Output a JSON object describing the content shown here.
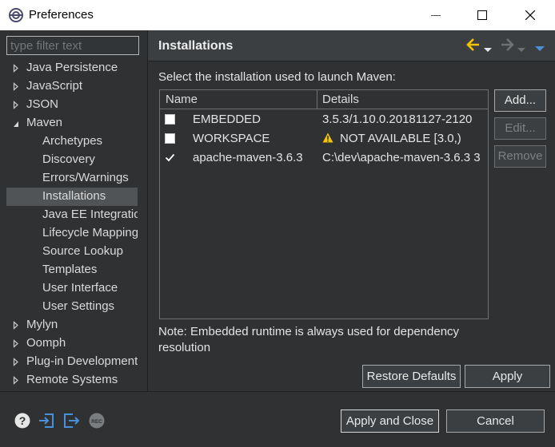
{
  "window": {
    "title": "Preferences",
    "min_label": "—",
    "max_label": "☐",
    "close_label": "✕"
  },
  "filter": {
    "placeholder": "type filter text"
  },
  "tree": [
    {
      "label": "Java Persistence",
      "level": 0,
      "arrow": "collapsed"
    },
    {
      "label": "JavaScript",
      "level": 0,
      "arrow": "collapsed"
    },
    {
      "label": "JSON",
      "level": 0,
      "arrow": "collapsed"
    },
    {
      "label": "Maven",
      "level": 0,
      "arrow": "expanded"
    },
    {
      "label": "Archetypes",
      "level": 1
    },
    {
      "label": "Discovery",
      "level": 1
    },
    {
      "label": "Errors/Warnings",
      "level": 1
    },
    {
      "label": "Installations",
      "level": 1,
      "selected": true
    },
    {
      "label": "Java EE Integration",
      "level": 1
    },
    {
      "label": "Lifecycle Mapping",
      "level": 1
    },
    {
      "label": "Source Lookup",
      "level": 1
    },
    {
      "label": "Templates",
      "level": 1
    },
    {
      "label": "User Interface",
      "level": 1
    },
    {
      "label": "User Settings",
      "level": 1
    },
    {
      "label": "Mylyn",
      "level": 0,
      "arrow": "collapsed"
    },
    {
      "label": "Oomph",
      "level": 0,
      "arrow": "collapsed"
    },
    {
      "label": "Plug-in Development",
      "level": 0,
      "arrow": "collapsed"
    },
    {
      "label": "Remote Systems",
      "level": 0,
      "arrow": "collapsed"
    }
  ],
  "page": {
    "title": "Installations",
    "instruction": "Select the installation used to launch Maven:",
    "columns": {
      "name": "Name",
      "details": "Details"
    },
    "rows": [
      {
        "name": "EMBEDDED",
        "details": "3.5.3/1.10.0.20181127-2120",
        "checked": false,
        "warning": false
      },
      {
        "name": "WORKSPACE",
        "details": "NOT AVAILABLE [3.0,)",
        "checked": false,
        "warning": true
      },
      {
        "name": "apache-maven-3.6.3",
        "details": "C:\\dev\\apache-maven-3.6.3 3",
        "checked": true,
        "warning": false
      }
    ],
    "buttons": {
      "add": "Add...",
      "edit": "Edit...",
      "remove": "Remove"
    },
    "note": "Note: Embedded runtime is always used for dependency resolution",
    "restore_defaults": "Restore Defaults",
    "apply": "Apply"
  },
  "bottom": {
    "apply_and_close": "Apply and Close",
    "cancel": "Cancel",
    "icons": [
      "help-icon",
      "import-icon",
      "export-icon",
      "record-icon"
    ]
  },
  "colors": {
    "accent_yellow": "#f5c400",
    "accent_blue": "#4a8fd9",
    "background": "#2f3133"
  }
}
